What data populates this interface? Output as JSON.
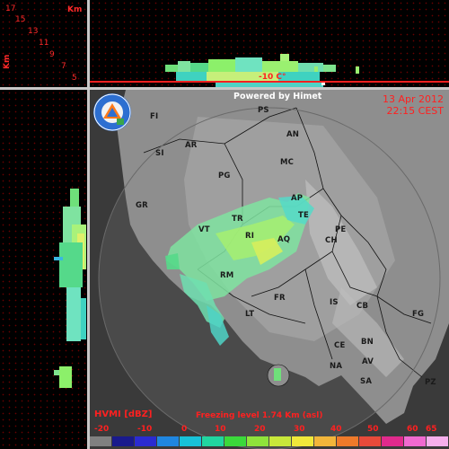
{
  "top_left_panel": {
    "unit_label": "Km",
    "side_label": "Km",
    "ticks": [
      "17",
      "15",
      "13",
      "11",
      "9",
      "7",
      "5"
    ]
  },
  "top_panel": {
    "freezing_label": "-10 C°"
  },
  "map": {
    "powered_by": "Powered by Himet",
    "date": "13 Apr 2012",
    "time": "22:15 CEST",
    "product": "HVMI [dBZ]",
    "freezing_level": "Freezing level  1.74 Km (asl)",
    "logo_text": "PROTEZIONE CIVILE REGIONE ABRUZZO",
    "cities": [
      "FI",
      "PS",
      "AN",
      "AR",
      "SI",
      "MC",
      "PG",
      "GR",
      "AP",
      "TE",
      "TR",
      "VT",
      "RI",
      "AQ",
      "PE",
      "CH",
      "RM",
      "FR",
      "IS",
      "CB",
      "FG",
      "LT",
      "CE",
      "BN",
      "NA",
      "AV",
      "SA",
      "PZ"
    ]
  },
  "colorbar": {
    "labels": [
      "-20",
      "-10",
      "0",
      "10",
      "20",
      "30",
      "40",
      "50",
      "60",
      "65"
    ],
    "colors": [
      "#808080",
      "#1a1a8c",
      "#2b2bd1",
      "#1f86e0",
      "#18c2d8",
      "#21d6a0",
      "#3bd93b",
      "#8fe33b",
      "#c8e83a",
      "#f0e83a",
      "#f2b53a",
      "#ee7a2a",
      "#e84a3a",
      "#e02a8c",
      "#f06ad0",
      "#f7b0ec"
    ]
  }
}
